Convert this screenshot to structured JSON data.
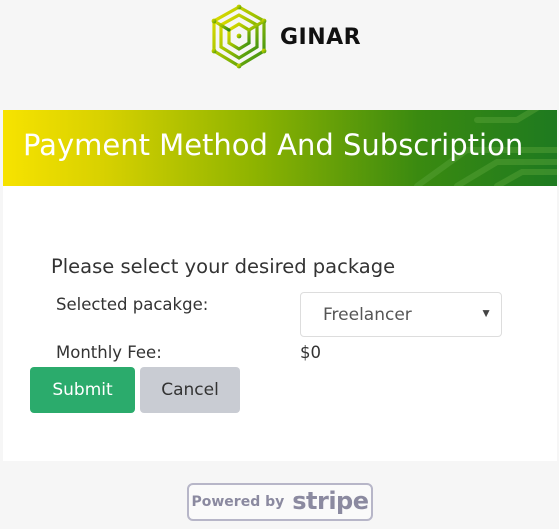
{
  "brand": {
    "name": "GINAR",
    "logo_icon": "hexagon-circuit-logo",
    "colors": {
      "yellow": "#f7e300",
      "green": "#1e7a20"
    }
  },
  "banner": {
    "title": "Payment Method And Subscription"
  },
  "form": {
    "prompt": "Please select your desired package",
    "package_label": "Selected pacakge:",
    "package_value": "Freelancer",
    "fee_label": "Monthly Fee:",
    "fee_value": "$0"
  },
  "buttons": {
    "submit_label": "Submit",
    "submit_color": "#2bab6c",
    "cancel_label": "Cancel",
    "cancel_color": "#c9ccd3"
  },
  "stripe_badge": {
    "powered_by": "Powered by",
    "brand": "stripe"
  }
}
